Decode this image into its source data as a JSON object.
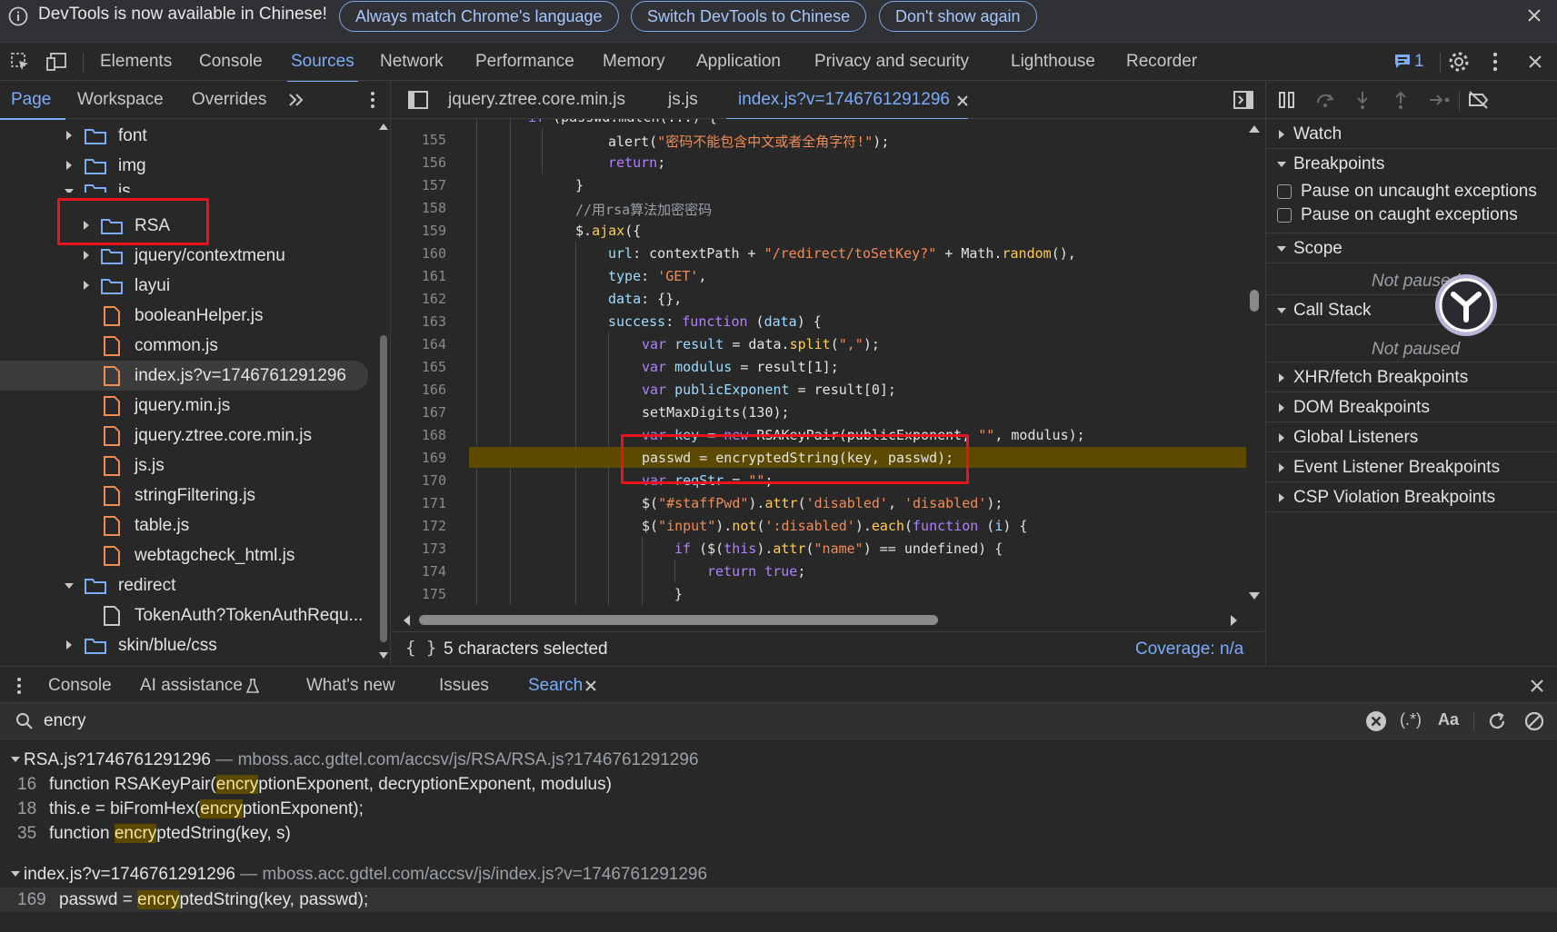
{
  "infobar": {
    "message": "DevTools is now available in Chinese!",
    "btn_match": "Always match Chrome's language",
    "btn_switch": "Switch DevTools to Chinese",
    "btn_dont_show": "Don't show again"
  },
  "main_tabs": [
    "Elements",
    "Console",
    "Sources",
    "Network",
    "Performance",
    "Memory",
    "Application",
    "Privacy and security",
    "Lighthouse",
    "Recorder"
  ],
  "issues_count": "1",
  "navigator": {
    "tabs": [
      "Page",
      "Workspace",
      "Overrides"
    ],
    "tree": [
      "font",
      "img",
      "js",
      "RSA",
      "jquery/contextmenu",
      "layui",
      "booleanHelper.js",
      "common.js",
      "index.js?v=1746761291296",
      "jquery.min.js",
      "jquery.ztree.core.min.js",
      "js.js",
      "stringFiltering.js",
      "table.js",
      "webtagcheck_html.js",
      "redirect",
      "TokenAuth?TokenAuthRequ...",
      "skin/blue/css"
    ]
  },
  "editor": {
    "tabs": [
      "jquery.ztree.core.min.js",
      "js.js",
      "index.js?v=1746761291296"
    ],
    "status_selection": "5 characters selected",
    "coverage": "Coverage: n/a",
    "lines": {
      "l155": "155",
      "l156": "156",
      "l157": "157",
      "l158": "158",
      "l159": "159",
      "l160": "160",
      "l161": "161",
      "l162": "162",
      "l163": "163",
      "l164": "164",
      "l165": "165",
      "l166": "166",
      "l167": "167",
      "l168": "168",
      "l169": "169",
      "l170": "170",
      "l171": "171",
      "l172": "172",
      "l173": "173",
      "l174": "174",
      "l175": "175"
    }
  },
  "debugger": {
    "watch": "Watch",
    "breakpoints": "Breakpoints",
    "pause_uncaught": "Pause on uncaught exceptions",
    "pause_caught": "Pause on caught exceptions",
    "scope": "Scope",
    "not_paused": "Not paused",
    "call_stack": "Call Stack",
    "xhr": "XHR/fetch Breakpoints",
    "dom": "DOM Breakpoints",
    "global": "Global Listeners",
    "event": "Event Listener Breakpoints",
    "csp": "CSP Violation Breakpoints"
  },
  "drawer": {
    "tabs": [
      "Console",
      "AI assistance",
      "What's new",
      "Issues",
      "Search"
    ],
    "search_value": "encry"
  },
  "results": {
    "file1": "RSA.js?1746761291296",
    "file1_url": "mboss.acc.gdtel.com/accsv/js/RSA/RSA.js?1746761291296",
    "file1_lines": [
      {
        "num": "16",
        "pre": "function RSAKeyPair(",
        "match": "encry",
        "post": "ptionExponent, decryptionExponent, modulus)"
      },
      {
        "num": "18",
        "pre": "this.e = biFromHex(",
        "match": "encry",
        "post": "ptionExponent);"
      },
      {
        "num": "35",
        "pre": "function ",
        "match": "encry",
        "post": "ptedString(key, s)"
      }
    ],
    "file2": "index.js?v=1746761291296",
    "file2_url": "mboss.acc.gdtel.com/accsv/js/index.js?v=1746761291296",
    "file2_lines": [
      {
        "num": "169",
        "pre": "passwd = ",
        "match": "encry",
        "post": "ptedString(key, passwd);"
      }
    ]
  }
}
